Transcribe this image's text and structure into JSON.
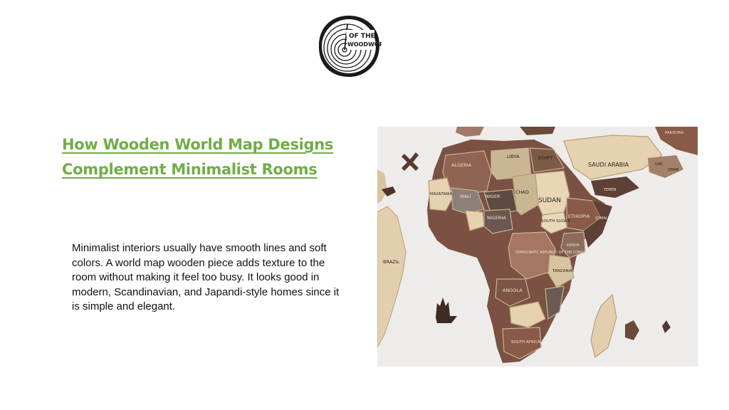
{
  "logo": {
    "text_line1": "OF THE",
    "text_line2": "WOODWORK"
  },
  "heading": {
    "line1": "How Wooden World Map Designs",
    "line2": "Complement Minimalist Rooms"
  },
  "body": {
    "paragraph": "Minimalist interiors usually have smooth lines and soft colors. A world map wooden piece adds texture to the room without making it feel too busy. It looks good in modern, Scandinavian, and Japandi-style homes since it is simple and elegant."
  },
  "photo": {
    "country_labels": [
      "LIBYA",
      "EGYPT",
      "SAUDI ARABIA",
      "ALGERIA",
      "MALI",
      "NIGER",
      "CHAD",
      "SUDAN",
      "SOUTH SUDAN",
      "ETHIOPIA",
      "MAURITANIA",
      "NIGERIA",
      "DEMOCRATIC REPUBLIC OF THE CONGO",
      "TANZANIA",
      "KENYA",
      "ANGOLA",
      "SOUTH AFRICA",
      "BRAZIL",
      "PAKISTAN",
      "UAE",
      "OMAN",
      "YEMEN",
      "SOMALIA"
    ],
    "colors": {
      "wall": "#eeecea",
      "dark_wood": "#6b4a3a",
      "walnut": "#8a5a48",
      "light_wood": "#e6d2b0",
      "grey_wood": "#7d7470"
    }
  }
}
